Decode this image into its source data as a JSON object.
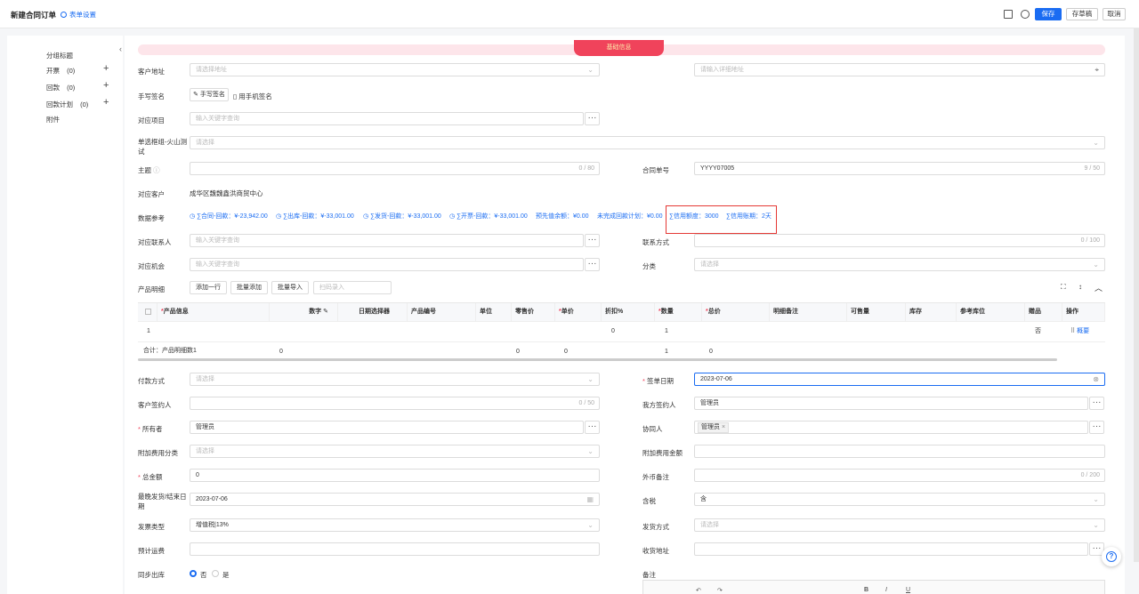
{
  "header": {
    "title": "新建合同订单",
    "form_settings": "表单设置",
    "save": "保存",
    "save_draft": "存草稿",
    "cancel": "取消"
  },
  "sidebar": {
    "items": [
      {
        "label": "分组标题",
        "count": ""
      },
      {
        "label": "开票",
        "count": "(0)"
      },
      {
        "label": "回款",
        "count": "(0)"
      },
      {
        "label": "回款计划",
        "count": "(0)"
      },
      {
        "label": "附件",
        "count": ""
      }
    ]
  },
  "banner": {
    "label": "基础信息"
  },
  "form": {
    "customer_address": {
      "label": "客户地址",
      "placeholder": "请选择地址",
      "detail_placeholder": "请输入详细地址"
    },
    "signature": {
      "label": "手写签名",
      "hand": "手写签名",
      "phone": "用手机签名"
    },
    "project": {
      "label": "对应项目",
      "placeholder": "输入关键字查询"
    },
    "single_select": {
      "label": "单选框组-火山测试",
      "placeholder": "请选择"
    },
    "subject": {
      "label": "主题",
      "count": "0 / 80"
    },
    "contract_no": {
      "label": "合同单号",
      "value": "YYYY07005",
      "count": "9 / 50"
    },
    "customer": {
      "label": "对应客户",
      "value": "成华区魏魏鑫洪商贸中心"
    },
    "data_ref": {
      "label": "数据参考",
      "items": [
        "∑合同-回款：¥-23,942.00",
        "∑出库-回款：¥-33,001.00",
        "∑发货-回款：¥-33,001.00",
        "∑开票-回款：¥-33,001.00",
        "预先值余额：¥0.00",
        "未完成回款计划：¥0.00",
        "∑信用额度：3000",
        "∑信用账期：2天"
      ]
    },
    "contact": {
      "label": "对应联系人",
      "placeholder": "输入关键字查询"
    },
    "contact_method": {
      "label": "联系方式",
      "count": "0 / 100"
    },
    "opportunity": {
      "label": "对应机会",
      "placeholder": "输入关键字查询"
    },
    "category": {
      "label": "分类",
      "placeholder": "请选择"
    },
    "product_detail": {
      "label": "产品明细",
      "add_row": "添加一行",
      "batch_add": "批量添加",
      "batch_import": "批量导入",
      "scan_placeholder": "扫码录入"
    },
    "payment_method": {
      "label": "付款方式",
      "placeholder": "请选择"
    },
    "sign_date": {
      "label": "签单日期",
      "value": "2023-07-06"
    },
    "customer_signer": {
      "label": "客户签约人",
      "count": "0 / 50"
    },
    "our_signer": {
      "label": "我方签约人",
      "value": "管理员"
    },
    "owner": {
      "label": "所有者",
      "value": "管理员"
    },
    "collaborator": {
      "label": "协同人",
      "value": "管理员"
    },
    "extra_fee_cat": {
      "label": "附加费用分类",
      "placeholder": "请选择"
    },
    "extra_fee_amount": {
      "label": "附加费用金额"
    },
    "total_amount": {
      "label": "总金额",
      "value": "0"
    },
    "fx_note": {
      "label": "外币备注",
      "count": "0 / 200"
    },
    "last_delivery": {
      "label": "最晚发货/结束日期",
      "value": "2023-07-06"
    },
    "tax": {
      "label": "含税",
      "value": "含"
    },
    "invoice_type": {
      "label": "发票类型",
      "value": "增值税|13%"
    },
    "delivery_method": {
      "label": "发货方式",
      "placeholder": "请选择"
    },
    "est_freight": {
      "label": "预计运费"
    },
    "receive_address": {
      "label": "收货地址"
    },
    "sync_out": {
      "label": "同步出库",
      "no": "否",
      "yes": "是"
    },
    "remark": {
      "label": "备注"
    }
  },
  "table": {
    "headers": [
      "产品信息",
      "数字",
      "日期选择器",
      "产品编号",
      "单位",
      "零售价",
      "单价",
      "折扣%",
      "数量",
      "总价",
      "明细备注",
      "可售量",
      "库存",
      "参考库位",
      "赠品",
      "操作"
    ],
    "row": {
      "index": "1",
      "discount": "0",
      "qty": "1",
      "gift": "否",
      "action": "概要"
    },
    "total": {
      "label": "合计：产品明细数1",
      "num": "0",
      "retail": "0",
      "price": "0",
      "qty": "1",
      "total": "0"
    }
  }
}
